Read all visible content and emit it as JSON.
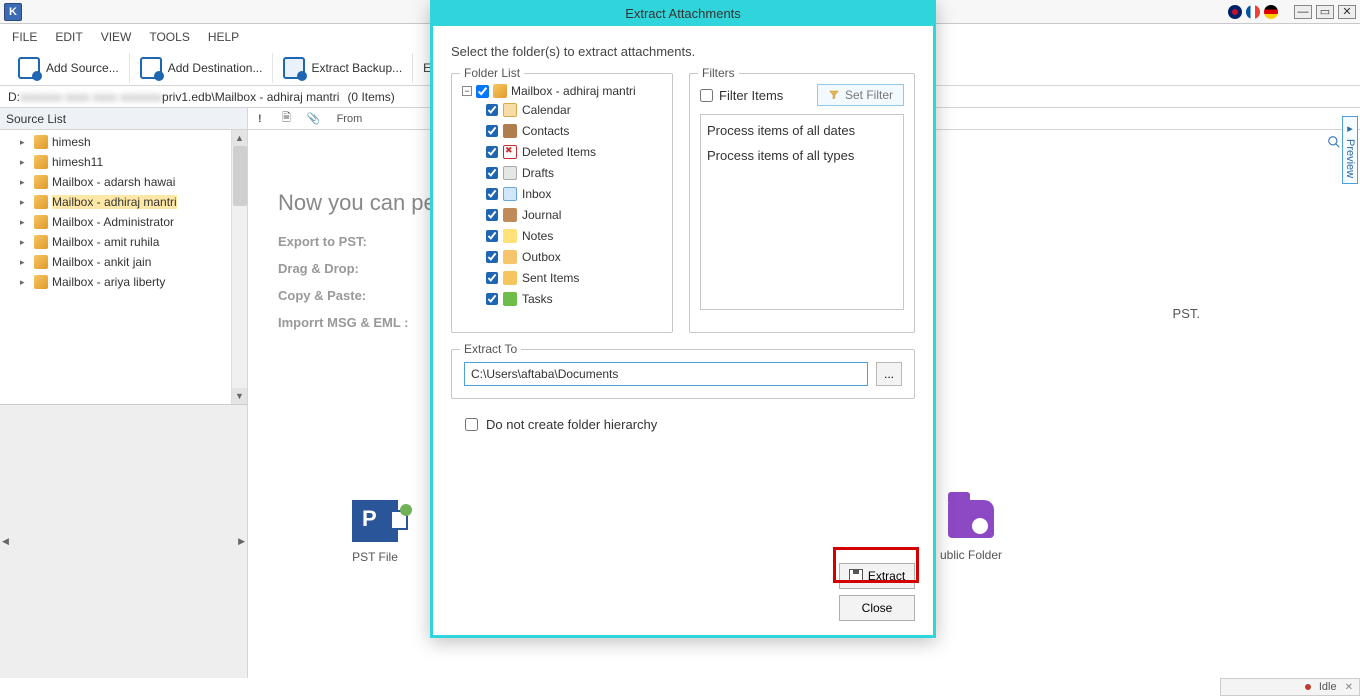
{
  "app_icon_letter": "K",
  "menu": {
    "file": "FILE",
    "edit": "EDIT",
    "view": "VIEW",
    "tools": "TOOLS",
    "help": "HELP"
  },
  "toolbar": {
    "add_source": "Add Source...",
    "add_destination": "Add Destination...",
    "extract_backup": "Extract Backup...",
    "export_m": "Export M"
  },
  "breadcrumb": {
    "drive": "D:",
    "blur": "xxxxxxx xxxx xxxx xxxxxxx",
    "tail": "priv1.edb\\Mailbox - adhiraj mantri",
    "count": "(0 Items)"
  },
  "source_pane": {
    "title": "Source List",
    "items": [
      {
        "label": "himesh",
        "selected": false
      },
      {
        "label": "himesh11",
        "selected": false
      },
      {
        "label": "Mailbox - adarsh hawai",
        "selected": false
      },
      {
        "label": "Mailbox - adhiraj mantri",
        "selected": true
      },
      {
        "label": "Mailbox - Administrator",
        "selected": false
      },
      {
        "label": "Mailbox - amit ruhila",
        "selected": false
      },
      {
        "label": "Mailbox - ankit jain",
        "selected": false
      },
      {
        "label": "Mailbox - ariya liberty",
        "selected": false
      }
    ]
  },
  "grid": {
    "cols": {
      "flag": "!",
      "from": "From"
    }
  },
  "promo": {
    "title": "Now you can per",
    "export": "Export to PST:",
    "drag": "Drag & Drop:",
    "copy": "Copy & Paste:",
    "import": "Imporrt MSG & EML :",
    "pst_suffix": "PST."
  },
  "cards": {
    "pst": "PST File",
    "public_folder": "ublic Folder"
  },
  "preview_tab": "Preview",
  "statusbar": {
    "text": "Idle"
  },
  "dialog": {
    "title": "Extract Attachments",
    "instruction": "Select the folder(s) to extract attachments.",
    "folder_list_label": "Folder List",
    "filters_label": "Filters",
    "filter_items_label": "Filter Items",
    "set_filter": "Set Filter",
    "filter_lines": {
      "dates": "Process items of all dates",
      "types": "Process items of all types"
    },
    "root_mailbox": "Mailbox - adhiraj mantri",
    "folders": [
      {
        "name": "Calendar",
        "icon": "ico-calendar"
      },
      {
        "name": "Contacts",
        "icon": "ico-contacts"
      },
      {
        "name": "Deleted Items",
        "icon": "ico-deleted"
      },
      {
        "name": "Drafts",
        "icon": "ico-drafts"
      },
      {
        "name": "Inbox",
        "icon": "ico-inbox"
      },
      {
        "name": "Journal",
        "icon": "ico-journal"
      },
      {
        "name": "Notes",
        "icon": "ico-notes"
      },
      {
        "name": "Outbox",
        "icon": "ico-outbox"
      },
      {
        "name": "Sent Items",
        "icon": "ico-sent"
      },
      {
        "name": "Tasks",
        "icon": "ico-tasks"
      }
    ],
    "extract_to_label": "Extract To",
    "extract_path": "C:\\Users\\aftaba\\Documents",
    "browse": "...",
    "no_hierarchy": "Do not create folder hierarchy",
    "btn_extract": "Extract",
    "btn_close": "Close"
  }
}
